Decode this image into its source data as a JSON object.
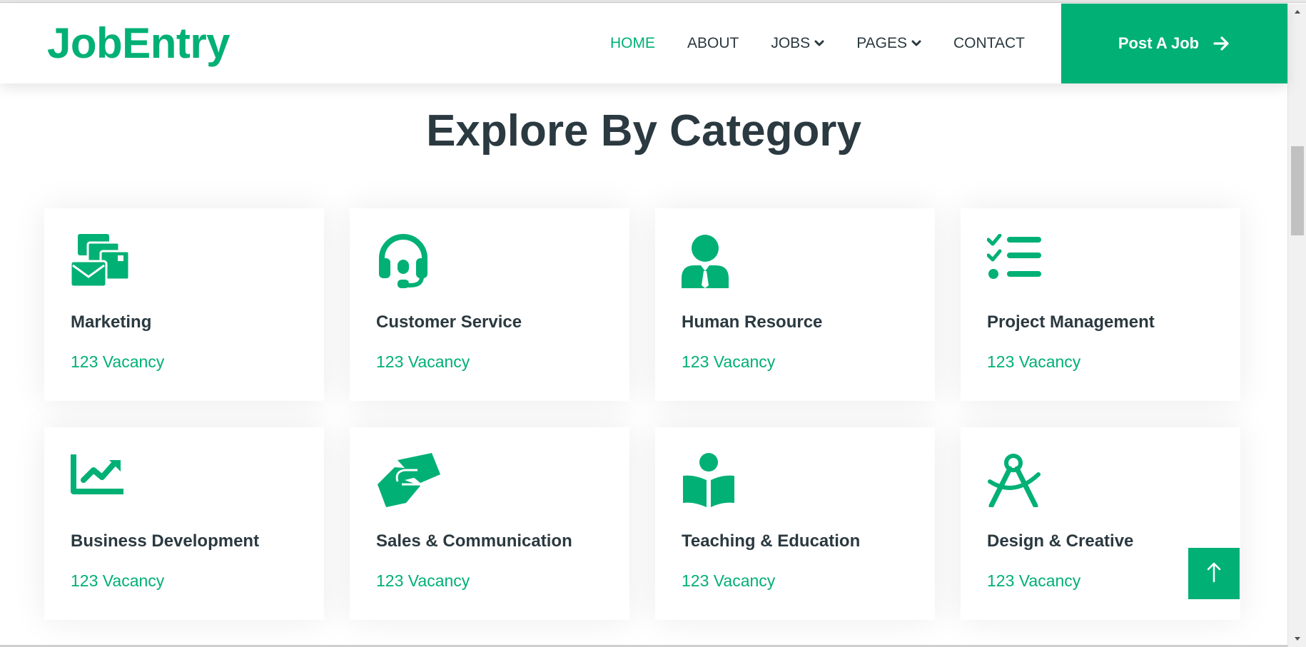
{
  "brand": {
    "name": "JobEntry"
  },
  "nav": {
    "items": [
      {
        "label": "HOME",
        "active": true
      },
      {
        "label": "ABOUT"
      },
      {
        "label": "JOBS",
        "dropdown": true
      },
      {
        "label": "PAGES",
        "dropdown": true
      },
      {
        "label": "CONTACT"
      }
    ],
    "cta_label": "Post A Job",
    "cta_icon": "arrow-right-icon"
  },
  "section": {
    "title": "Explore By Category"
  },
  "categories": [
    {
      "name": "Marketing",
      "vacancy": "123 Vacancy",
      "icon": "mail-bulk-icon"
    },
    {
      "name": "Customer Service",
      "vacancy": "123 Vacancy",
      "icon": "headset-icon"
    },
    {
      "name": "Human Resource",
      "vacancy": "123 Vacancy",
      "icon": "user-tie-icon"
    },
    {
      "name": "Project Management",
      "vacancy": "123 Vacancy",
      "icon": "tasks-icon"
    },
    {
      "name": "Business Development",
      "vacancy": "123 Vacancy",
      "icon": "chart-line-icon"
    },
    {
      "name": "Sales & Communication",
      "vacancy": "123 Vacancy",
      "icon": "hands-helping-icon"
    },
    {
      "name": "Teaching & Education",
      "vacancy": "123 Vacancy",
      "icon": "book-reader-icon"
    },
    {
      "name": "Design & Creative",
      "vacancy": "123 Vacancy",
      "icon": "drafting-compass-icon"
    }
  ],
  "scroll_top": {
    "icon": "arrow-up-icon"
  },
  "colors": {
    "primary": "#00b074",
    "dark": "#2b3940"
  }
}
